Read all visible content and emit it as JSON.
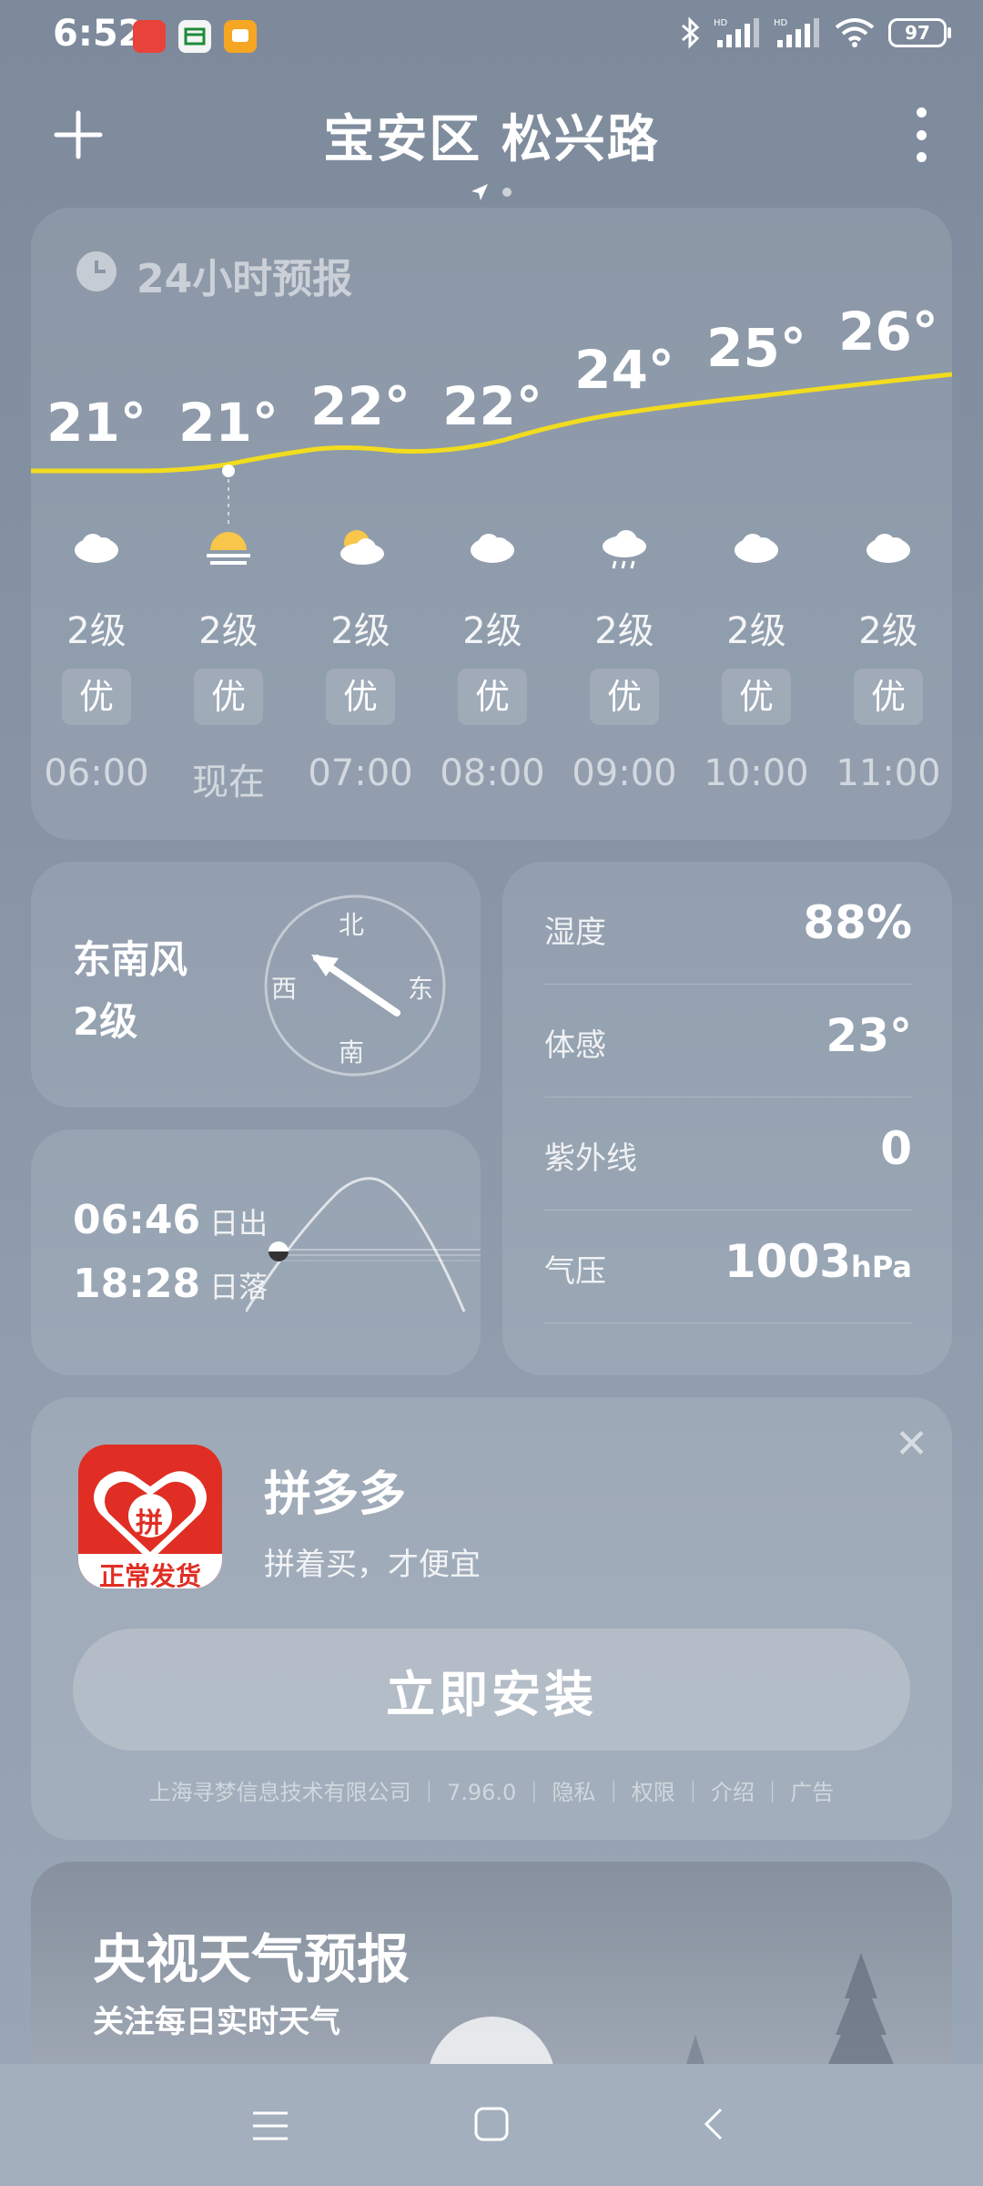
{
  "status_bar": {
    "time": "6:52",
    "battery": "97"
  },
  "header": {
    "title": "宝安区 松兴路"
  },
  "hourly": {
    "title": "24小时预报",
    "columns": [
      {
        "temp": "21°",
        "icon": "cloudy-icon",
        "wind": "2级",
        "aqi": "优",
        "time": "06:00"
      },
      {
        "temp": "21°",
        "icon": "sunrise-icon",
        "wind": "2级",
        "aqi": "优",
        "time": "现在"
      },
      {
        "temp": "22°",
        "icon": "partly-cloudy-icon",
        "wind": "2级",
        "aqi": "优",
        "time": "07:00"
      },
      {
        "temp": "22°",
        "icon": "cloudy-icon",
        "wind": "2级",
        "aqi": "优",
        "time": "08:00"
      },
      {
        "temp": "24°",
        "icon": "light-rain-icon",
        "wind": "2级",
        "aqi": "优",
        "time": "09:00"
      },
      {
        "temp": "25°",
        "icon": "cloudy-icon",
        "wind": "2级",
        "aqi": "优",
        "time": "10:00"
      },
      {
        "temp": "26°",
        "icon": "cloudy-icon",
        "wind": "2级",
        "aqi": "优",
        "time": "11:00"
      }
    ]
  },
  "wind": {
    "direction": "东南风",
    "level": "2级",
    "compass": {
      "n": "北",
      "s": "南",
      "e": "东",
      "w": "西"
    }
  },
  "sun": {
    "sunrise_time": "06:46",
    "sunrise_label": "日出",
    "sunset_time": "18:28",
    "sunset_label": "日落"
  },
  "details": {
    "humidity_label": "湿度",
    "humidity": "88%",
    "feels_label": "体感",
    "feels": "23°",
    "uv_label": "紫外线",
    "uv": "0",
    "pressure_label": "气压",
    "pressure": "1003",
    "pressure_unit": "hPa"
  },
  "ad": {
    "icon_badge": "正常发货",
    "icon_char": "拼",
    "name": "拼多多",
    "slogan": "拼着买，才便宜",
    "install_label": "立即安装",
    "meta": "上海寻梦信息技术有限公司 ｜ 7.96.0 ｜ 隐私 ｜ 权限 ｜ 介绍 ｜ 广告"
  },
  "cctv": {
    "title": "央视天气预报",
    "subtitle": "关注每日实时天气"
  },
  "colors": {
    "temp_line": "#f2dc1e",
    "ad_red": "#e02e24"
  }
}
